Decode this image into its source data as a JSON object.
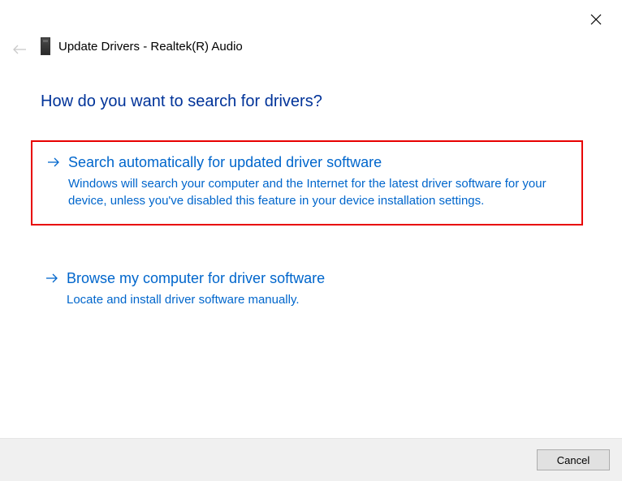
{
  "window": {
    "title": "Update Drivers - Realtek(R) Audio"
  },
  "heading": "How do you want to search for drivers?",
  "options": [
    {
      "title": "Search automatically for updated driver software",
      "description": "Windows will search your computer and the Internet for the latest driver software for your device, unless you've disabled this feature in your device installation settings.",
      "highlighted": true
    },
    {
      "title": "Browse my computer for driver software",
      "description": "Locate and install driver software manually.",
      "highlighted": false
    }
  ],
  "footer": {
    "cancel_label": "Cancel"
  }
}
